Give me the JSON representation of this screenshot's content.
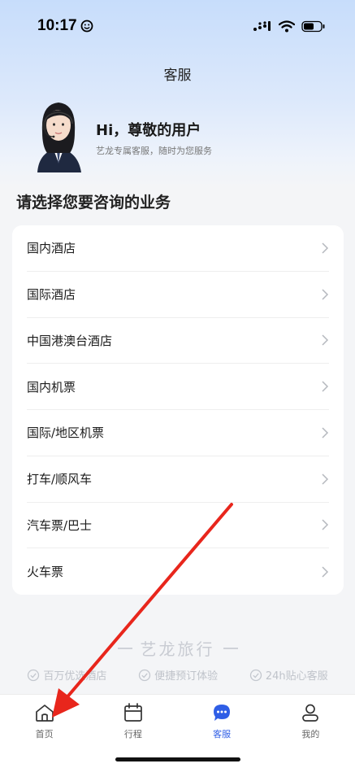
{
  "status_bar": {
    "time": "10:17"
  },
  "header": {
    "title": "客服"
  },
  "profile": {
    "greeting": "Hi，尊敬的用户",
    "subtitle": "艺龙专属客服，随时为您服务"
  },
  "section": {
    "title": "请选择您要咨询的业务"
  },
  "menu": {
    "items": [
      {
        "label": "国内酒店"
      },
      {
        "label": "国际酒店"
      },
      {
        "label": "中国港澳台酒店"
      },
      {
        "label": "国内机票"
      },
      {
        "label": "国际/地区机票"
      },
      {
        "label": "打车/顺风车"
      },
      {
        "label": "汽车票/巴士"
      },
      {
        "label": "火车票"
      }
    ]
  },
  "brand": {
    "name": "艺龙旅行"
  },
  "features": [
    {
      "label": "百万优选酒店"
    },
    {
      "label": "便捷预订体验"
    },
    {
      "label": "24h贴心客服"
    }
  ],
  "tabbar": {
    "tabs": [
      {
        "label": "首页",
        "icon": "home-icon"
      },
      {
        "label": "行程",
        "icon": "calendar-icon"
      },
      {
        "label": "客服",
        "icon": "chat-bubble-icon",
        "active": true
      },
      {
        "label": "我的",
        "icon": "person-icon"
      }
    ]
  },
  "colors": {
    "accent": "#2f5ee6",
    "arrow": "#e8261c"
  }
}
